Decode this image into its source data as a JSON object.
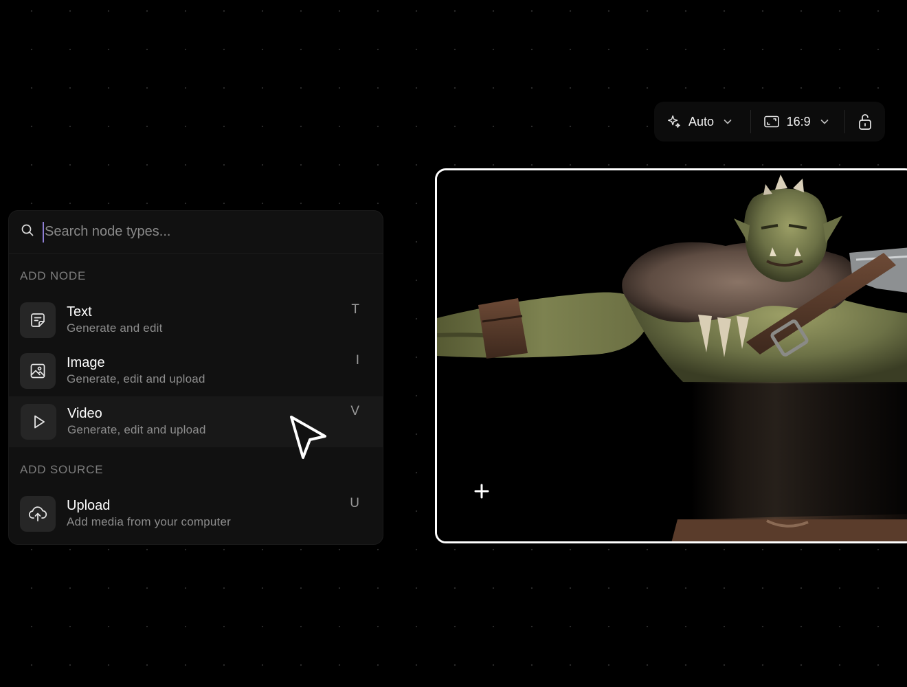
{
  "toolbar": {
    "mode_label": "Auto",
    "ratio_label": "16:9",
    "icons": [
      "sparkle-icon",
      "chevron-down-icon",
      "aspect-ratio-icon",
      "chevron-down-icon",
      "unlock-icon"
    ]
  },
  "node_menu": {
    "search_placeholder": "Search node types...",
    "add_node_title": "ADD NODE",
    "add_source_title": "ADD SOURCE",
    "nodes": [
      {
        "title": "Text",
        "subtitle": "Generate and edit",
        "shortcut": "T",
        "icon": "text-note-icon"
      },
      {
        "title": "Image",
        "subtitle": "Generate, edit and upload",
        "shortcut": "I",
        "icon": "image-icon"
      },
      {
        "title": "Video",
        "subtitle": "Generate, edit and upload",
        "shortcut": "V",
        "icon": "play-icon"
      }
    ],
    "sources": [
      {
        "title": "Upload",
        "subtitle": "Add media from your computer",
        "shortcut": "U",
        "icon": "cloud-upload-icon"
      }
    ]
  },
  "preview": {
    "image_subject": "orc-warrior-render",
    "add_icon": "plus-icon"
  },
  "colors": {
    "background": "#000000",
    "panel": "#111111",
    "icon_tile": "#262626",
    "caret": "#8f7fd6",
    "frame_border": "#ffffff"
  }
}
